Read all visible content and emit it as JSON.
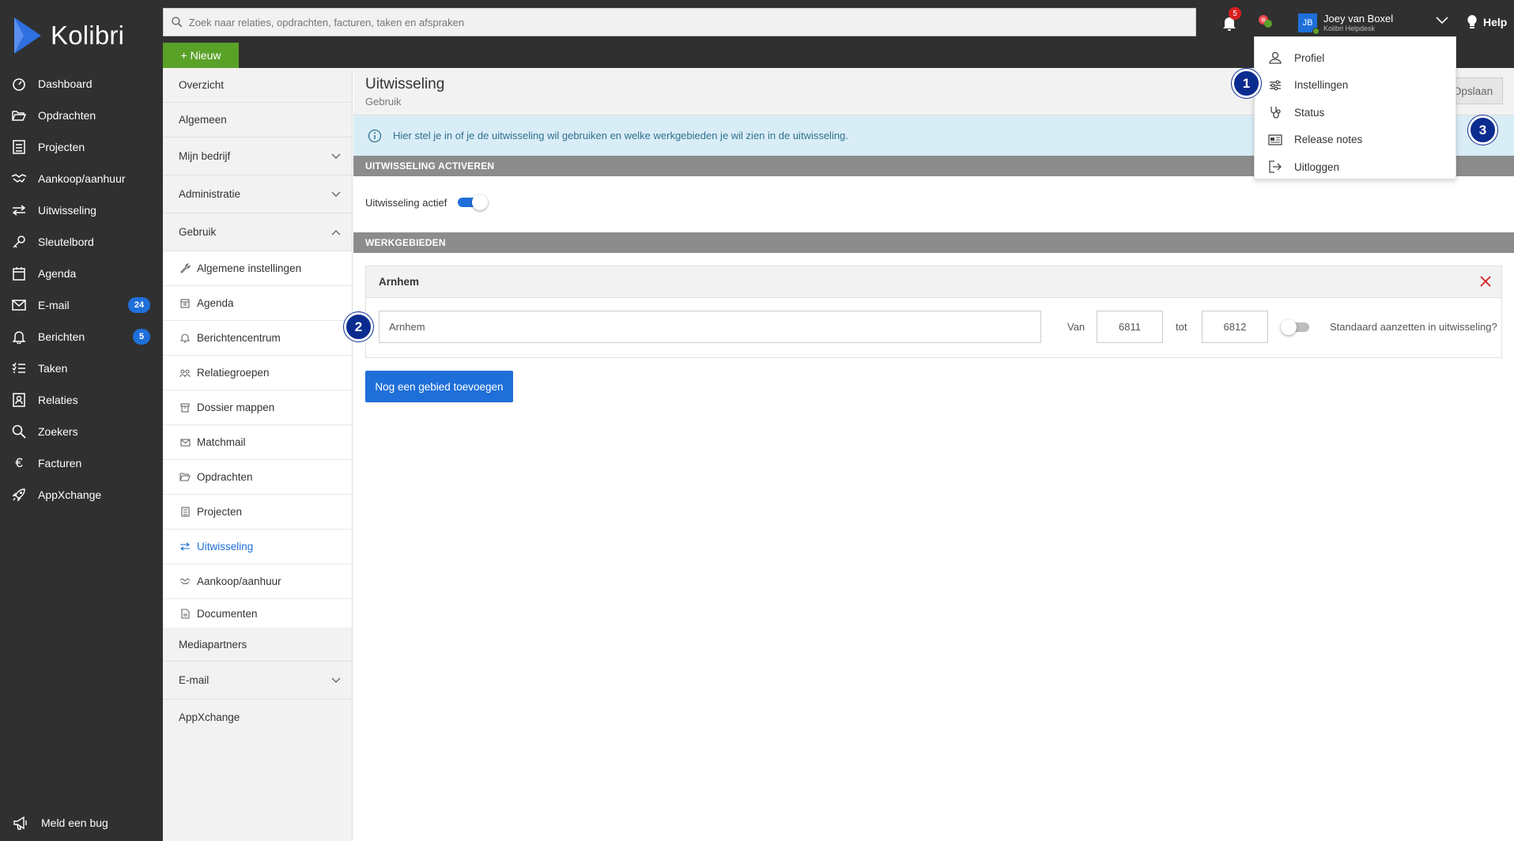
{
  "app": {
    "name": "Kolibri"
  },
  "leftnav": {
    "items": [
      {
        "label": "Dashboard",
        "icon": "dashboard-icon"
      },
      {
        "label": "Opdrachten",
        "icon": "folder-open-icon"
      },
      {
        "label": "Projecten",
        "icon": "projects-icon"
      },
      {
        "label": "Aankoop/aanhuur",
        "icon": "handshake-icon"
      },
      {
        "label": "Uitwisseling",
        "icon": "exchange-icon"
      },
      {
        "label": "Sleutelbord",
        "icon": "key-icon"
      },
      {
        "label": "Agenda",
        "icon": "calendar-icon"
      },
      {
        "label": "E-mail",
        "icon": "mail-icon",
        "badge": "24"
      },
      {
        "label": "Berichten",
        "icon": "bell-icon",
        "badge": "5"
      },
      {
        "label": "Taken",
        "icon": "tasks-icon"
      },
      {
        "label": "Relaties",
        "icon": "contacts-icon"
      },
      {
        "label": "Zoekers",
        "icon": "search-icon"
      },
      {
        "label": "Facturen",
        "icon": "euro-icon"
      },
      {
        "label": "AppXchange",
        "icon": "rocket-icon"
      }
    ],
    "bug": "Meld een bug"
  },
  "topbar": {
    "search_placeholder": "Zoek naar relaties, opdrachten, facturen, taken en afspraken",
    "new_label": "+ Nieuw",
    "bell_count": "5",
    "user": {
      "initials": "JB",
      "name": "Joey van Boxel",
      "org": "Kolibri Helpdesk"
    },
    "help": "Help"
  },
  "settings_nav": {
    "top": [
      "Overzicht",
      "Algemeen",
      "Mijn bedrijf",
      "Administratie",
      "Gebruik"
    ],
    "sub": [
      {
        "label": "Algemene instellingen",
        "icon": "wrench-icon"
      },
      {
        "label": "Agenda",
        "icon": "calendar-icon"
      },
      {
        "label": "Berichtencentrum",
        "icon": "bell-icon"
      },
      {
        "label": "Relatiegroepen",
        "icon": "group-icon"
      },
      {
        "label": "Dossier mappen",
        "icon": "archive-icon"
      },
      {
        "label": "Matchmail",
        "icon": "mail-icon"
      },
      {
        "label": "Opdrachten",
        "icon": "folder-open-icon"
      },
      {
        "label": "Projecten",
        "icon": "projects-icon"
      },
      {
        "label": "Uitwisseling",
        "icon": "exchange-icon"
      },
      {
        "label": "Aankoop/aanhuur",
        "icon": "handshake-icon"
      },
      {
        "label": "Documenten",
        "icon": "document-icon"
      }
    ],
    "bottom": [
      "Mediapartners",
      "E-mail",
      "AppXchange"
    ]
  },
  "page": {
    "title": "Uitwisseling",
    "subtitle": "Gebruik",
    "save": "Opslaan",
    "info": "Hier stel je in of je de uitwisseling wil gebruiken en welke werkgebieden je wil zien in de uitwisseling.",
    "section_activate": "UITWISSELING ACTIVEREN",
    "toggle_label": "Uitwisseling actief",
    "toggle_on": true,
    "section_areas": "WERKGEBIEDEN",
    "area": {
      "header": "Arnhem",
      "value": "Arnhem",
      "from_label": "Van",
      "from": "6811",
      "to_label": "tot",
      "to": "6812",
      "default_label": "Standaard aanzetten in uitwisseling?",
      "default_on": false
    },
    "add_area": "Nog een gebied toevoegen"
  },
  "dropdown": {
    "items": [
      {
        "label": "Profiel",
        "icon": "user-icon"
      },
      {
        "label": "Instellingen",
        "icon": "sliders-icon"
      },
      {
        "label": "Status",
        "icon": "stethoscope-icon"
      },
      {
        "label": "Release notes",
        "icon": "newspaper-icon"
      },
      {
        "label": "Uitloggen",
        "icon": "logout-icon"
      }
    ]
  },
  "markers": [
    "1",
    "2",
    "3"
  ],
  "colors": {
    "sidebar": "#303030",
    "accent": "#1e6fd9",
    "new": "#5aa128",
    "marker": "#0b2c8f"
  }
}
